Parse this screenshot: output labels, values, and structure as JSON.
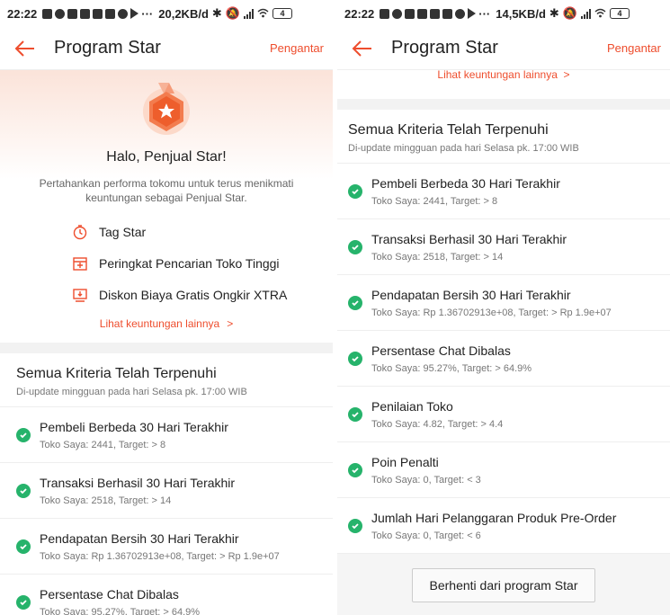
{
  "left": {
    "status": {
      "time": "22:22",
      "speed": "20,2KB/d",
      "battery": "4"
    },
    "header": {
      "title": "Program Star",
      "help_link": "Pengantar"
    },
    "hero": {
      "medal_label": "Star",
      "title": "Halo, Penjual Star!",
      "description": "Pertahankan performa tokomu untuk terus menikmati keuntungan sebagai Penjual Star.",
      "benefits": [
        {
          "label": "Tag Star",
          "icon": "stopwatch-icon"
        },
        {
          "label": "Peringkat Pencarian Toko Tinggi",
          "icon": "store-search-icon"
        },
        {
          "label": "Diskon Biaya Gratis Ongkir XTRA",
          "icon": "shipping-discount-icon"
        }
      ],
      "more_link": "Lihat keuntungan lainnya"
    },
    "criteria": {
      "title": "Semua Kriteria Telah Terpenuhi",
      "subtitle": "Di-update mingguan pada hari Selasa pk. 17:00 WIB",
      "items": [
        {
          "title": "Pembeli Berbeda 30 Hari Terakhir",
          "detail": "Toko Saya: 2441, Target: > 8"
        },
        {
          "title": "Transaksi Berhasil 30 Hari Terakhir",
          "detail": "Toko Saya: 2518, Target: > 14"
        },
        {
          "title": "Pendapatan Bersih 30 Hari Terakhir",
          "detail": "Toko Saya: Rp 1.36702913e+08, Target: > Rp 1.9e+07"
        },
        {
          "title": "Persentase Chat Dibalas",
          "detail": "Toko Saya: 95.27%, Target: > 64.9%"
        }
      ]
    }
  },
  "right": {
    "status": {
      "time": "22:22",
      "speed": "14,5KB/d",
      "battery": "4"
    },
    "header": {
      "title": "Program Star",
      "help_link": "Pengantar"
    },
    "more_link_cut": "Lihat keuntungan lainnya",
    "criteria": {
      "title": "Semua Kriteria Telah Terpenuhi",
      "subtitle": "Di-update mingguan pada hari Selasa pk. 17:00 WIB",
      "items": [
        {
          "title": "Pembeli Berbeda 30 Hari Terakhir",
          "detail": "Toko Saya: 2441, Target: > 8"
        },
        {
          "title": "Transaksi Berhasil 30 Hari Terakhir",
          "detail": "Toko Saya: 2518, Target: > 14"
        },
        {
          "title": "Pendapatan Bersih 30 Hari Terakhir",
          "detail": "Toko Saya: Rp 1.36702913e+08, Target: > Rp 1.9e+07"
        },
        {
          "title": "Persentase Chat Dibalas",
          "detail": "Toko Saya: 95.27%, Target: > 64.9%"
        },
        {
          "title": "Penilaian Toko",
          "detail": "Toko Saya: 4.82, Target: > 4.4"
        },
        {
          "title": "Poin Penalti",
          "detail": "Toko Saya: 0, Target: < 3"
        },
        {
          "title": "Jumlah Hari Pelanggaran Produk Pre-Order",
          "detail": "Toko Saya: 0, Target: < 6"
        }
      ]
    },
    "footer": {
      "stop_button": "Berhenti dari program Star"
    }
  },
  "colors": {
    "accent": "#ee4d2d",
    "success": "#26b36b",
    "hero_tint": "#fbe3d9"
  }
}
